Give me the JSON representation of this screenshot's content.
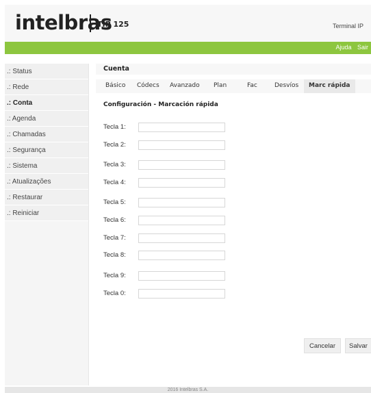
{
  "header": {
    "logo": "intelbras",
    "product": "TIP 125",
    "device_label": "Terminal IP"
  },
  "topbar": {
    "help": "Ajuda",
    "exit": "Sair"
  },
  "sidebar": {
    "items": [
      {
        "label": ".: Status"
      },
      {
        "label": ".: Rede"
      },
      {
        "label": ".: Conta",
        "active": true
      },
      {
        "label": ".: Agenda"
      },
      {
        "label": ".: Chamadas"
      },
      {
        "label": ".: Segurança"
      },
      {
        "label": ".: Sistema"
      },
      {
        "label": ".: Atualizações"
      },
      {
        "label": ".: Restaurar"
      },
      {
        "label": ".: Reiniciar"
      }
    ]
  },
  "main": {
    "section_title": "Cuenta",
    "tabs": [
      {
        "label": "Básico"
      },
      {
        "label": "Códecs"
      },
      {
        "label": "Avanzado"
      },
      {
        "label": "Plan"
      },
      {
        "label": "Fac"
      },
      {
        "label": "Desvíos"
      },
      {
        "label": "Marc rápida",
        "active": true
      }
    ],
    "subtitle": "Configuración - Marcación rápida",
    "keys": [
      {
        "label": "Tecla 1:",
        "value": ""
      },
      {
        "label": "Tecla 2:",
        "value": ""
      },
      {
        "label": "Tecla 3:",
        "value": ""
      },
      {
        "label": "Tecla 4:",
        "value": ""
      },
      {
        "label": "Tecla 5:",
        "value": ""
      },
      {
        "label": "Tecla 6:",
        "value": ""
      },
      {
        "label": "Tecla 7:",
        "value": ""
      },
      {
        "label": "Tecla 8:",
        "value": ""
      },
      {
        "label": "Tecla 9:",
        "value": ""
      },
      {
        "label": "Tecla 0:",
        "value": ""
      }
    ],
    "cancel_label": "Cancelar",
    "save_label": "Salvar"
  },
  "footer": {
    "copyright": "2016 Intelbras S.A."
  },
  "colors": {
    "accent_green": "#8dc63f"
  }
}
